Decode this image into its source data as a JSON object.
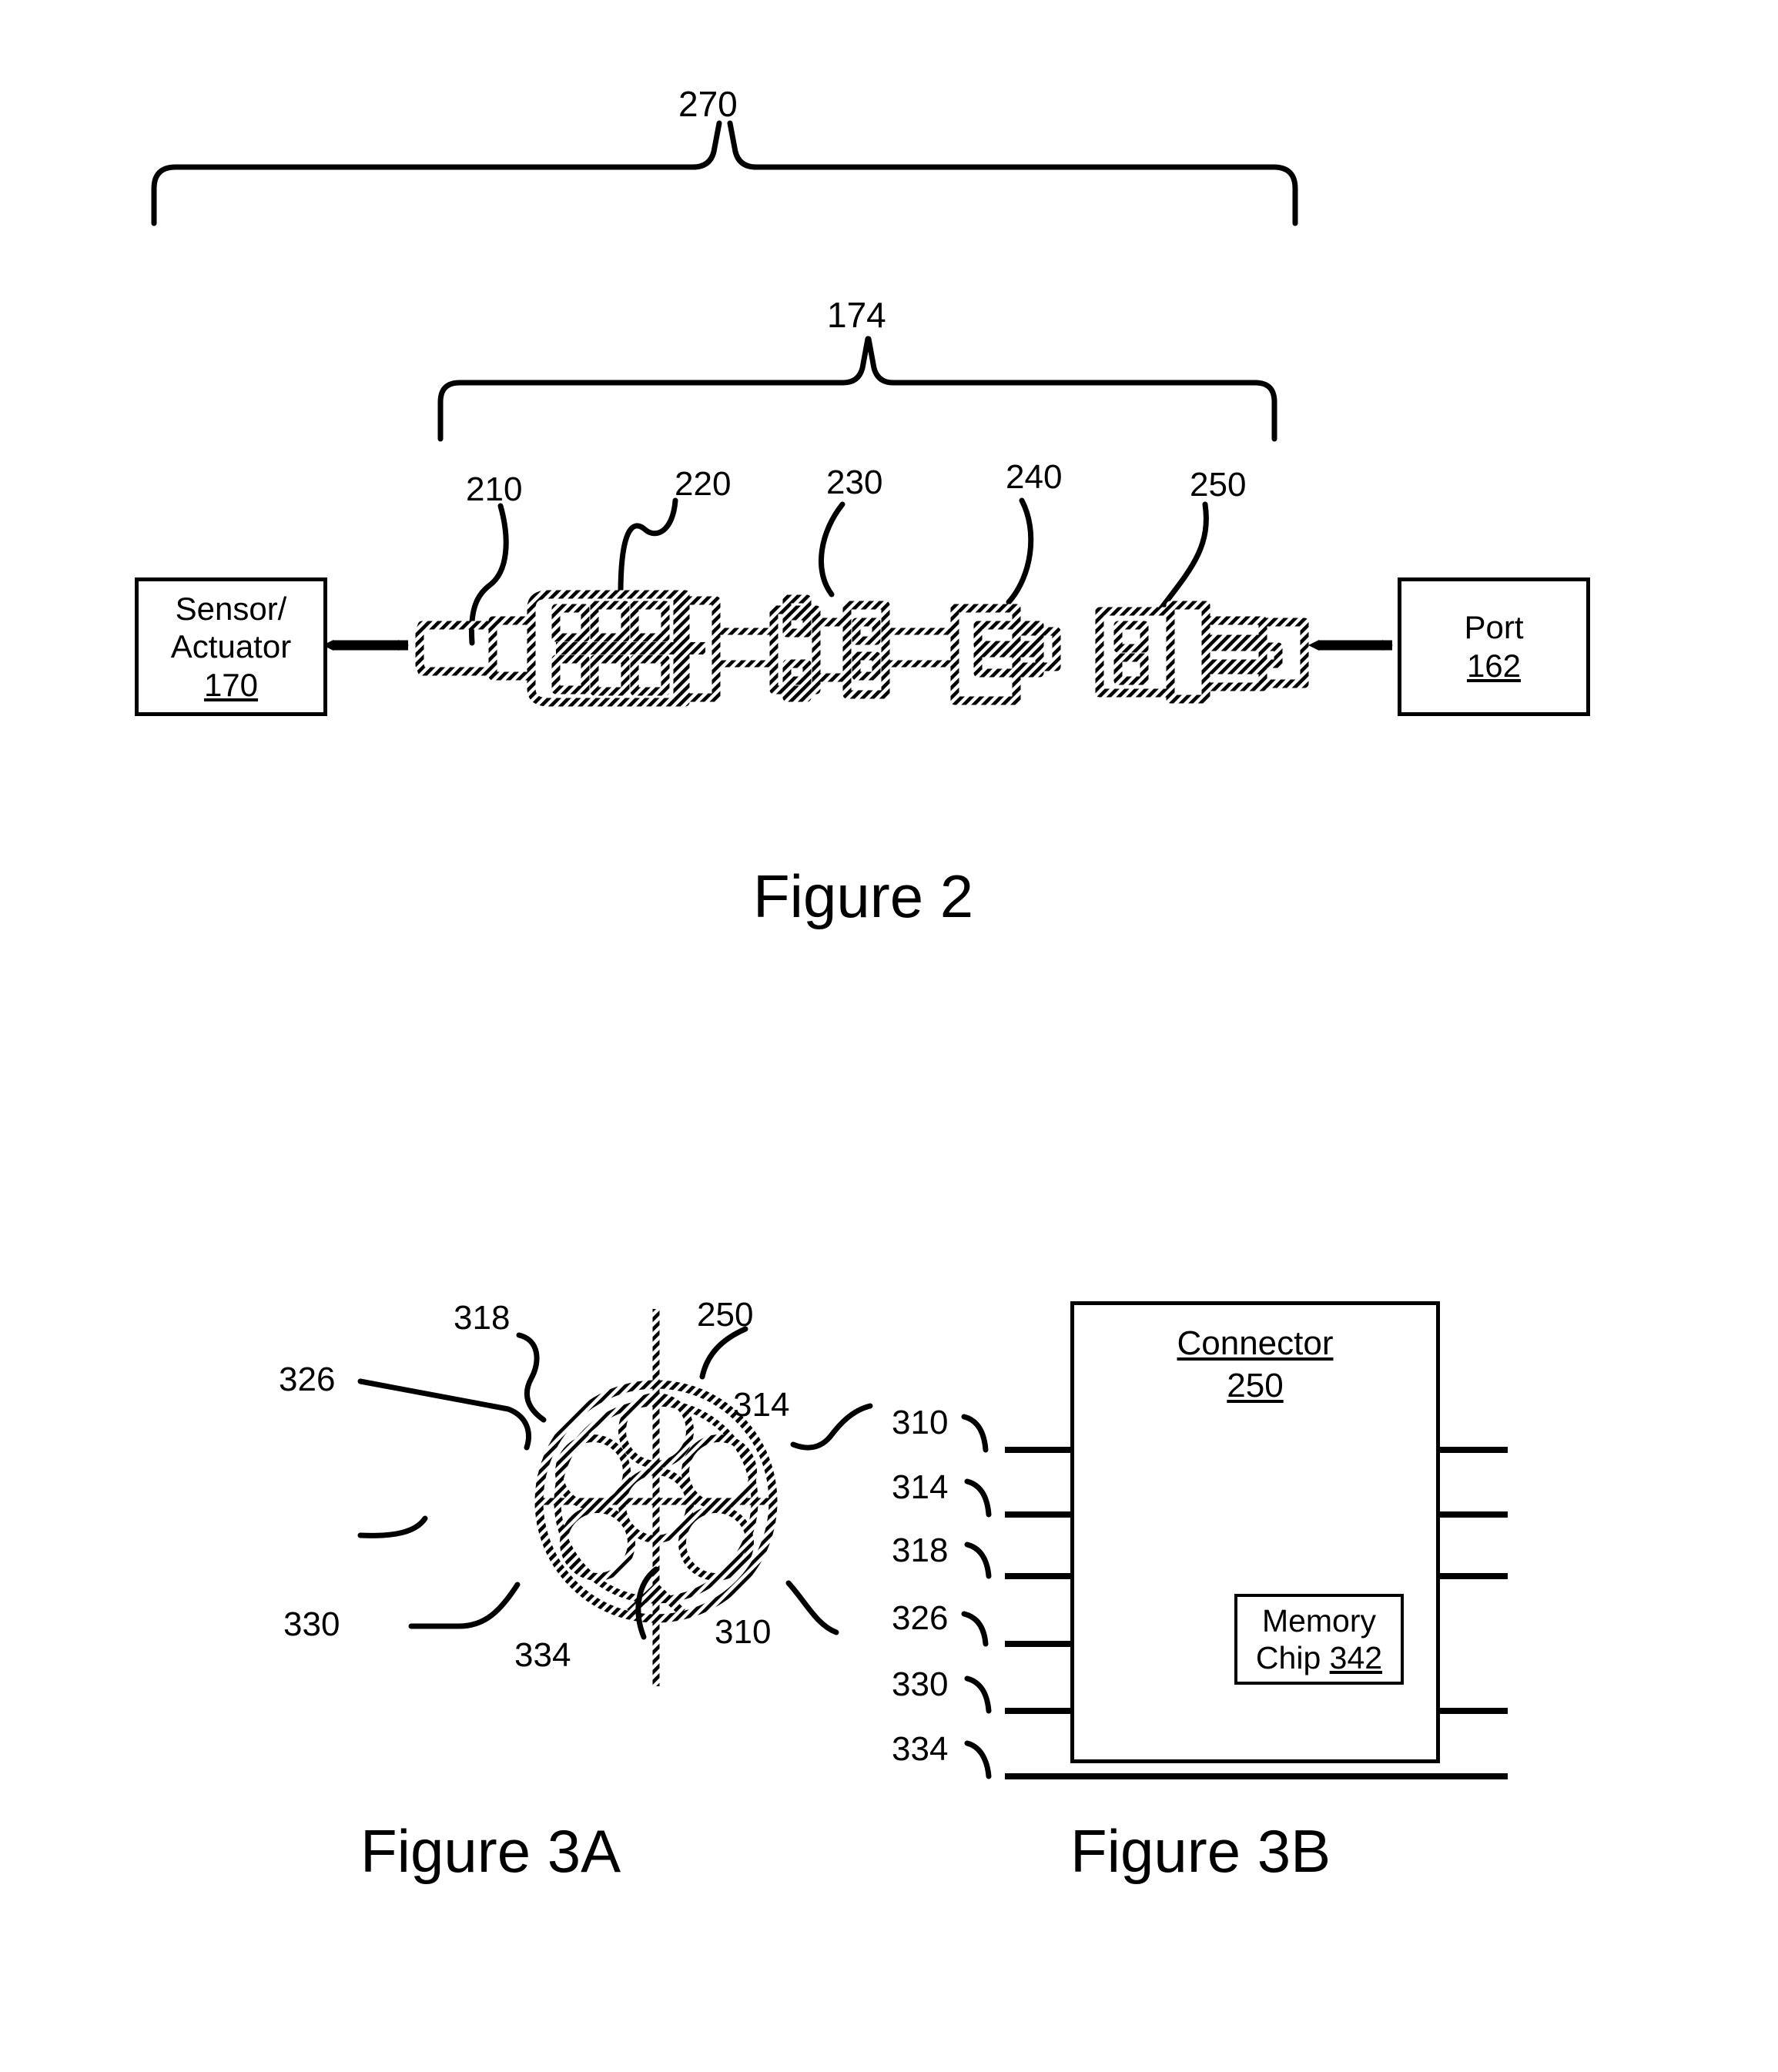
{
  "document": {
    "type": "patent-figure-sheet",
    "figures": [
      "Figure 2",
      "Figure 3A",
      "Figure 3B"
    ]
  },
  "figure2": {
    "caption": "Figure 2",
    "bracket_outer_label": "270",
    "bracket_inner_label": "174",
    "left_box": {
      "line1": "Sensor/",
      "line2": "Actuator",
      "ref": "170"
    },
    "right_box": {
      "line1": "Port",
      "ref": "162"
    },
    "component_refs": [
      {
        "label": "210"
      },
      {
        "label": "220"
      },
      {
        "label": "230"
      },
      {
        "label": "240"
      },
      {
        "label": "250"
      }
    ]
  },
  "figure3a": {
    "caption": "Figure 3A",
    "callouts": [
      {
        "label": "318"
      },
      {
        "label": "250"
      },
      {
        "label": "326"
      },
      {
        "label": "314"
      },
      {
        "label": "330"
      },
      {
        "label": "334"
      },
      {
        "label": "310"
      }
    ]
  },
  "figure3b": {
    "caption": "Figure 3B",
    "block_title_line1": "Connector",
    "block_title_line2": "250",
    "memory_chip_line1": "Memory",
    "memory_chip_line2_text": "Chip ",
    "memory_chip_line2_ref": "342",
    "pin_labels": [
      "310",
      "314",
      "318",
      "326",
      "330",
      "334"
    ]
  },
  "colors": {
    "ink": "#000000",
    "paper": "#ffffff"
  }
}
